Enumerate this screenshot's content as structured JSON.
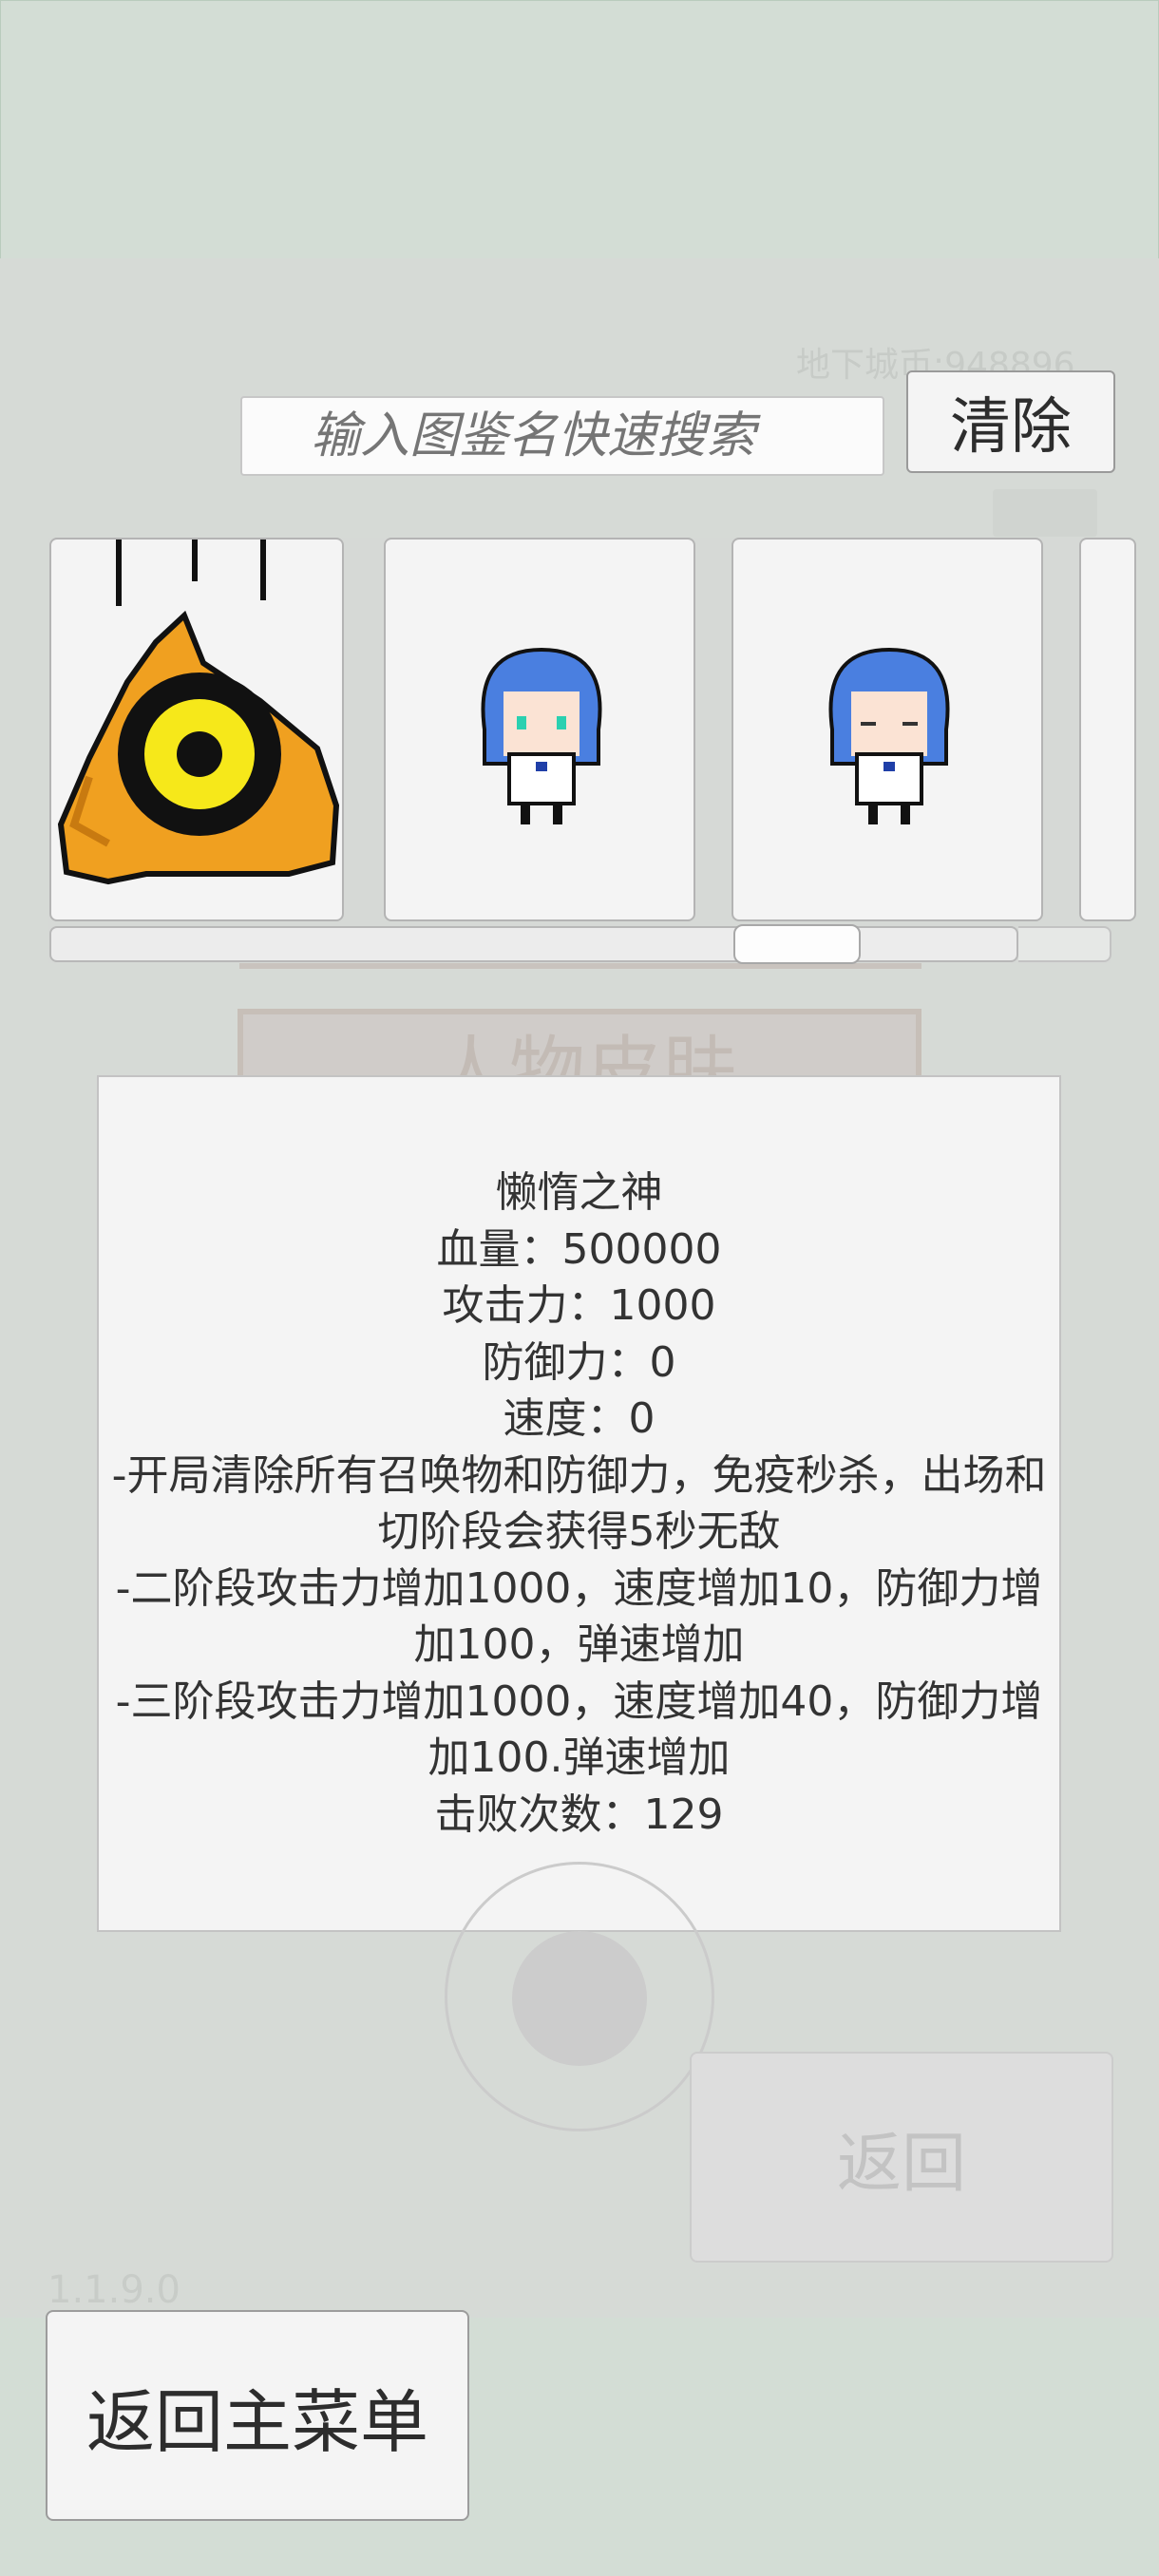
{
  "background": {
    "currency_text": "地下城币:948896",
    "ghost_title": "人物皮肤",
    "version": "1.1.9.0",
    "return_label": "返回"
  },
  "search": {
    "placeholder": "输入图鉴名快速搜索",
    "clear_label": "清除"
  },
  "gallery": {
    "cards": [
      {
        "icon": "lazy-god-boss-icon"
      },
      {
        "icon": "blue-hair-girl-icon"
      },
      {
        "icon": "blue-hair-girl-sleepy-icon"
      }
    ],
    "scroll_position": 0.75
  },
  "detail": {
    "name": "懒惰之神",
    "hp": "血量：500000",
    "attack": "攻击力：1000",
    "defense": "防御力：0",
    "speed": "速度：0",
    "skill1_line1": "-开局清除所有召唤物和防御力，免疫秒杀，出场和",
    "skill1_line2": "切阶段会获得5秒无敌",
    "skill2_line1": "-二阶段攻击力增加1000，速度增加10，防御力增",
    "skill2_line2": "加100，弹速增加",
    "skill3_line1": "-三阶段攻击力增加1000，速度增加40，防御力增",
    "skill3_line2": "加100.弹速增加",
    "defeats": "击败次数：129"
  },
  "footer": {
    "main_menu_label": "返回主菜单"
  },
  "colors": {
    "frame": "#d3ddd5",
    "panel": "#f4f4f4",
    "boss_orange": "#f0a020",
    "boss_eye": "#f6e81a",
    "girl_hair": "#4a7fe0"
  }
}
